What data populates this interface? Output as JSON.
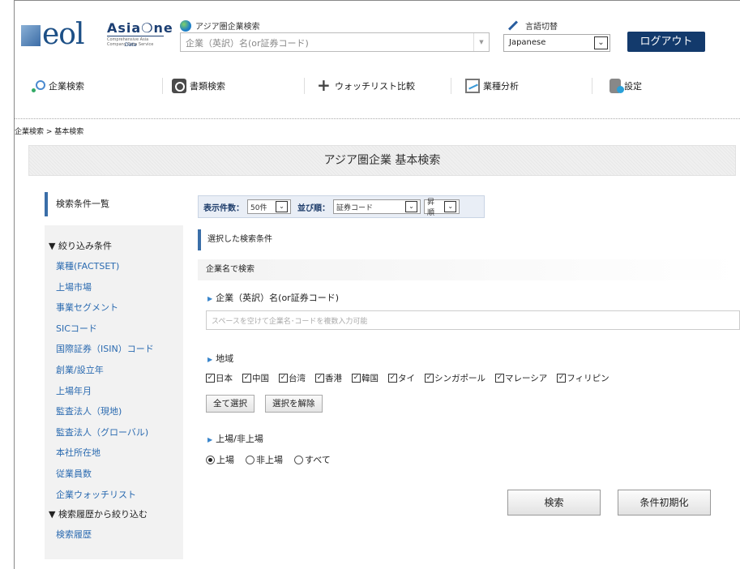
{
  "header": {
    "logo_brand": "eol",
    "logo_asia": "Asia❍ne",
    "logo_sub": "Comprehensive Asia Company Data Service",
    "logo_data": "Data",
    "quick_search_label": "アジア圏企業検索",
    "quick_search_placeholder": "企業（英訳）名(or証券コード)",
    "lang_label": "言語切替",
    "lang_value": "Japanese",
    "logout_label": "ログアウト"
  },
  "nav": [
    {
      "label": "企業検索",
      "icon": "company-search-icon"
    },
    {
      "label": "書類検索",
      "icon": "document-search-icon"
    },
    {
      "label": "ウォッチリスト比較",
      "icon": "watchlist-add-icon"
    },
    {
      "label": "業種分析",
      "icon": "industry-chart-icon"
    },
    {
      "label": "設定",
      "icon": "settings-icon"
    }
  ],
  "breadcrumb": "企業検索 > 基本検索",
  "page_title": "アジア圏企業 基本検索",
  "sidebar": {
    "heading": "検索条件一覧",
    "group1": "▼ 絞り込み条件",
    "filters": [
      "業種(FACTSET)",
      "上場市場",
      "事業セグメント",
      "SICコード",
      "国際証券（ISIN）コード",
      "創業/設立年",
      "上場年月",
      "監査法人（現地)",
      "監査法人（グローバル)",
      "本社所在地",
      "従業員数",
      "企業ウォッチリスト"
    ],
    "group2": "▼ 検索履歴から絞り込む",
    "history": "検索履歴"
  },
  "controls": {
    "count_label": "表示件数：",
    "count_value": "50件",
    "sort_label": "並び順：",
    "sort_value": "証券コード",
    "order_value": "昇順"
  },
  "criteria": {
    "selected_heading": "選択した検索条件",
    "company_heading": "企業名で検索",
    "company_field_label": "企業（英訳）名(or証券コード)",
    "company_placeholder": "スペースを空けて企業名･コードを複数入力可能",
    "region_label": "地域",
    "regions": [
      "日本",
      "中国",
      "台湾",
      "香港",
      "韓国",
      "タイ",
      "シンガポール",
      "マレーシア",
      "フィリピン"
    ],
    "select_all": "全て選択",
    "deselect_all": "選択を解除",
    "listing_label": "上場/非上場",
    "listing_options": [
      "上場",
      "非上場",
      "すべて"
    ],
    "listing_selected": "上場",
    "search_button": "検索",
    "reset_button": "条件初期化"
  },
  "colors": {
    "brand": "#133a6c",
    "accent": "#3a6ea8",
    "link": "#2a6ab0"
  }
}
